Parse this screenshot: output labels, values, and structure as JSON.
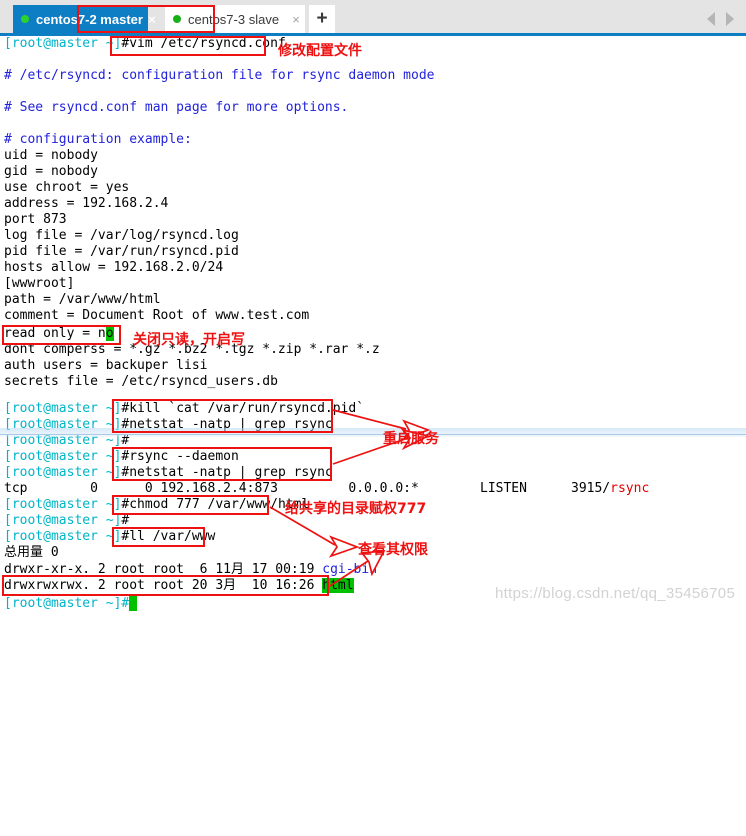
{
  "window": {
    "tabs": [
      {
        "label": "centos7-2 master",
        "status_dot_color": "#2dd32d",
        "close_label": "×",
        "active": true
      },
      {
        "label": "centos7-3 slave",
        "status_dot_color": "#17b017",
        "close_label": "×",
        "active": false
      }
    ],
    "new_tab_label": "+",
    "scroll_left_icon": "chevron-left-icon",
    "scroll_right_icon": "chevron-right-icon",
    "accent_color": "#0d7dc4"
  },
  "colors": {
    "prompt": "#00b4c8",
    "comment": "#2222dd",
    "annotation": "#ee1111",
    "cursor_bg": "#00c000",
    "dir_blue": "#2222dd",
    "exec_red": "#e60000"
  },
  "terminal": {
    "prompt": "[root@master ~]#",
    "lines": {
      "l01_prompt": "[root@master ~]",
      "l01_cmd": "#vim /etc/rsyncd.conf",
      "l03": "# /etc/rsyncd: configuration file for rsync daemon mode",
      "l05": "# See rsyncd.conf man page for more options.",
      "l07": "# configuration example:",
      "l08": "uid = nobody",
      "l09": "gid = nobody",
      "l10": "use chroot = yes",
      "l11": "address = 192.168.2.4",
      "l12": "port 873",
      "l13": "log file = /var/log/rsyncd.log",
      "l14": "pid file = /var/run/rsyncd.pid",
      "l15": "hosts allow = 192.168.2.0/24",
      "l16": "[wwwroot]",
      "l17": "path = /var/www/html",
      "l18": "comment = Document Root of www.test.com",
      "l19_a": "read only = n",
      "l19_cursor": "o",
      "l20": "dont comperss = *.gz *.bz2 *.tgz *.zip *.rar *.z",
      "l21": "auth users = backuper lisi",
      "l22": "secrets file = /etc/rsyncd_users.db",
      "l24_cmd": "#kill `cat /var/run/rsyncd.pid`",
      "l25_cmd": "#netstat -natp | grep rsync",
      "l26_cmd": "#",
      "l27_cmd": "#rsync --daemon",
      "l28_cmd": "#netstat -natp | grep rsync",
      "l29_a": "tcp        0      0 192.168.2.4:873         0.0.0.0:*",
      "l29_b": "LISTEN",
      "l29_c": "3915/",
      "l29_d": "rsync",
      "l30_cmd": "#chmod 777 /var/www/html",
      "l31_cmd": "#",
      "l32_cmd": "#ll /var/www",
      "l33": "总用量 0",
      "l34_a": "drwxr-xr-x. 2 root root  6 11月 17 00:19 ",
      "l34_b": "cgi-bin",
      "l35_a": "drwxrwxrwx. 2 root root 20 3月  10 16:26 ",
      "l35_b": "html",
      "l36_prompt": "[root@master ~]#"
    }
  },
  "annotations": [
    {
      "name": "annotation-edit-config",
      "text": "修改配置文件"
    },
    {
      "name": "annotation-readonly",
      "text": "关闭只读，开启写"
    },
    {
      "name": "annotation-restart-service",
      "text": "重启服务"
    },
    {
      "name": "annotation-chmod777",
      "text": "给共享的目录赋权777"
    },
    {
      "name": "annotation-check-perms",
      "text": "查看其权限"
    }
  ],
  "watermark": "https://blog.csdn.net/qq_35456705"
}
